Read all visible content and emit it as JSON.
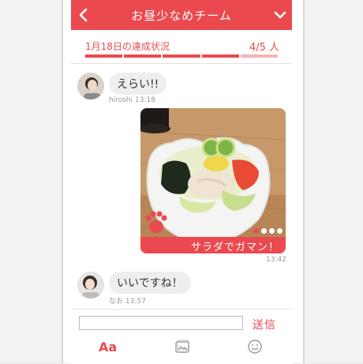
{
  "header": {
    "title": "お昼少なめチーム"
  },
  "progress": {
    "label": "1月18日の達成状況",
    "count": "4/5 人",
    "achieved": 4,
    "total": 5
  },
  "messages": [
    {
      "text": "えらい!!",
      "meta": "hiroshi 13:18"
    },
    {
      "caption": "サラダでガマン！",
      "time": "13:42",
      "photo_pages": 4,
      "current_page": 1
    },
    {
      "text": "いいですね！",
      "meta": "なお 13:57"
    }
  ],
  "composer": {
    "placeholder": "",
    "send_label": "送信",
    "text_tool_label": "Aa"
  },
  "colors": {
    "accent": "#ea4a4f",
    "bubble": "#eeeeee"
  },
  "icons": [
    "back-icon",
    "chevron-down-icon",
    "paw-icon",
    "image-icon",
    "smiley-icon"
  ]
}
